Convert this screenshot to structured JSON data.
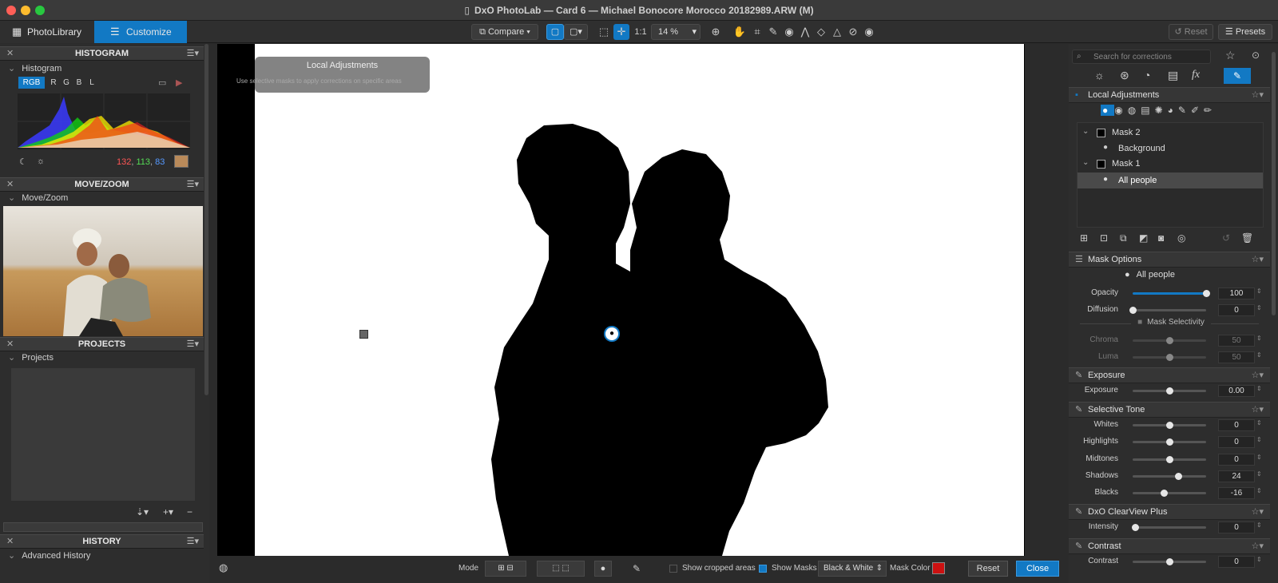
{
  "window": {
    "title": "DxO PhotoLab — Card 6 — Michael Bonocore Morocco 20182989.ARW (M)"
  },
  "toolbar": {
    "tab_library": "PhotoLibrary",
    "tab_customize": "Customize",
    "compare_label": "Compare",
    "one_to_one": "1:1",
    "zoom_value": "14 %",
    "reset_label": "Reset",
    "presets_label": "Presets"
  },
  "left": {
    "histogram_title": "HISTOGRAM",
    "histogram_sub": "Histogram",
    "channels": [
      "RGB",
      "R",
      "G",
      "B",
      "L"
    ],
    "rgb_r": "132",
    "rgb_g": "113",
    "rgb_b": "83",
    "swatch_color": "#b98a5a",
    "movezoom_title": "MOVE/ZOOM",
    "movezoom_sub": "Move/Zoom",
    "projects_title": "PROJECTS",
    "projects_sub": "Projects",
    "history_title": "HISTORY",
    "history_sub": "Advanced History"
  },
  "viewer": {
    "tooltip_title": "Local Adjustments",
    "tooltip_text": "Use selective masks to apply corrections on specific areas",
    "help": "?"
  },
  "bottom": {
    "mode_label": "Mode",
    "show_cropped": "Show cropped areas",
    "show_masks": "Show Masks",
    "mask_view": "Black & White",
    "mask_color_label": "Mask Color",
    "mask_color": "#cc1111",
    "reset": "Reset",
    "close": "Close"
  },
  "right": {
    "search_placeholder": "Search for corrections",
    "local_adjustments": "Local Adjustments",
    "masks": [
      {
        "name": "Mask 2",
        "child": "Background"
      },
      {
        "name": "Mask 1",
        "child": "All people"
      }
    ],
    "mask_options": "Mask Options",
    "selected_mask": "All people",
    "opacity_label": "Opacity",
    "opacity": "100",
    "diffusion_label": "Diffusion",
    "diffusion": "0",
    "mask_selectivity": "Mask Selectivity",
    "chroma_label": "Chroma",
    "chroma": "50",
    "luma_label": "Luma",
    "luma": "50",
    "exposure_section": "Exposure",
    "exposure_label": "Exposure",
    "exposure": "0.00",
    "selective_tone": "Selective Tone",
    "whites_label": "Whites",
    "whites": "0",
    "highlights_label": "Highlights",
    "highlights": "0",
    "midtones_label": "Midtones",
    "midtones": "0",
    "shadows_label": "Shadows",
    "shadows": "24",
    "blacks_label": "Blacks",
    "blacks": "-16",
    "clearview": "DxO ClearView Plus",
    "intensity_label": "Intensity",
    "intensity": "0",
    "contrast_section": "Contrast",
    "contrast_label": "Contrast",
    "contrast": "0"
  },
  "colors": {
    "accent": "#1279c4",
    "panel": "#2d2d2d"
  }
}
